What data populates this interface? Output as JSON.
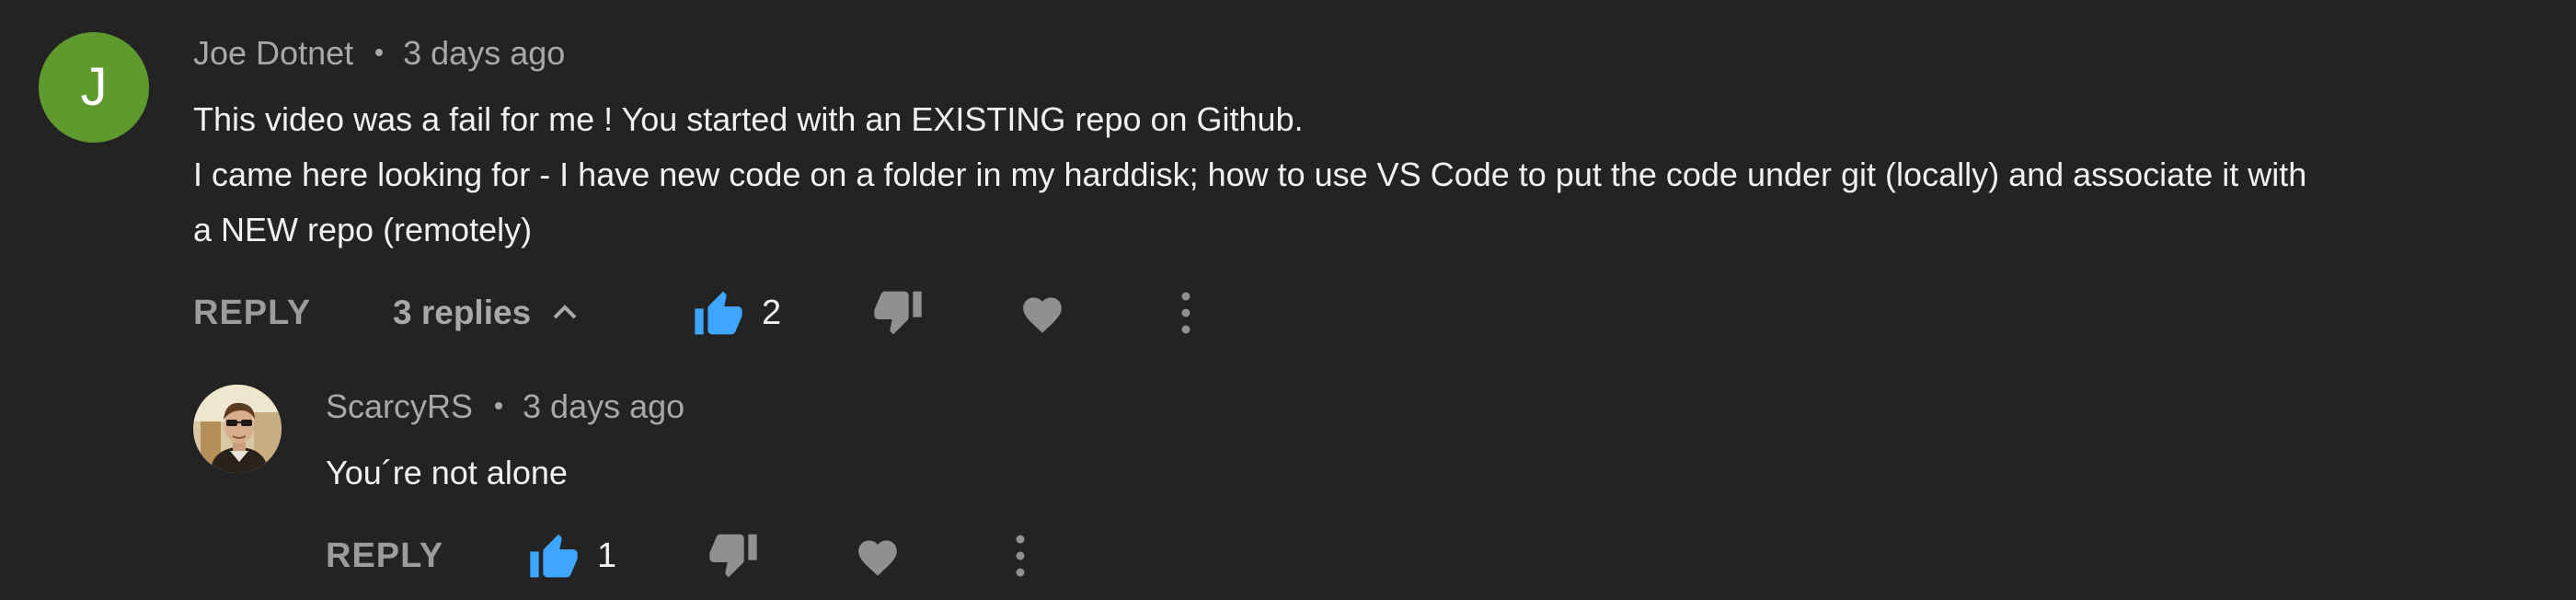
{
  "comment": {
    "avatar_letter": "J",
    "avatar_color": "#5e9a2e",
    "author": "Joe Dotnet",
    "time": "3 days ago",
    "text_lines": [
      "This video was a fail for me ! You started with an EXISTING repo on Github.",
      "I came here looking for - I have new code on a folder in my harddisk; how to use VS Code to put the code under git (locally) and associate it with",
      "a NEW repo (remotely)"
    ],
    "actions": {
      "reply_label": "REPLY",
      "replies_label": "3 replies",
      "like_count": "2",
      "like_icon": "thumbs-up-icon",
      "dislike_icon": "thumbs-down-icon",
      "heart_icon": "heart-icon",
      "more_icon": "more-vertical-icon"
    }
  },
  "reply": {
    "avatar": "user-photo",
    "author": "ScarcyRS",
    "time": "3 days ago",
    "text": "You´re not alone",
    "actions": {
      "reply_label": "REPLY",
      "like_count": "1"
    }
  },
  "colors": {
    "background": "#232323",
    "like_active": "#3ea6ff",
    "muted_icon": "#909090",
    "text": "#f1f1f1",
    "secondary_text": "#a8a8a8"
  }
}
